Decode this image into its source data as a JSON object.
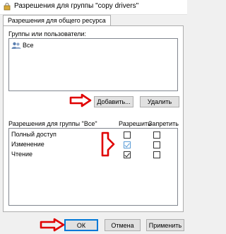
{
  "window": {
    "title": "Разрешения для группы \"copy drivers\"",
    "tab": "Разрешения для общего ресурса"
  },
  "groups": {
    "label": "Группы или пользователи:",
    "items": [
      {
        "name": "Все",
        "icon": "users-icon"
      }
    ],
    "add_button": "Добавить...",
    "remove_button": "Удалить"
  },
  "permissions": {
    "label": "Разрешения для группы \"Все\"",
    "allow_header": "Разрешить",
    "deny_header": "Запретить",
    "rows": [
      {
        "name": "Полный доступ",
        "allow": false,
        "deny": false
      },
      {
        "name": "Изменение",
        "allow": true,
        "deny": false
      },
      {
        "name": "Чтение",
        "allow": true,
        "deny": false
      }
    ]
  },
  "footer": {
    "ok": "ОК",
    "cancel": "Отмена",
    "apply": "Применить"
  },
  "colors": {
    "annotation_arrow": "#e00000",
    "focus_border": "#0078d7"
  }
}
